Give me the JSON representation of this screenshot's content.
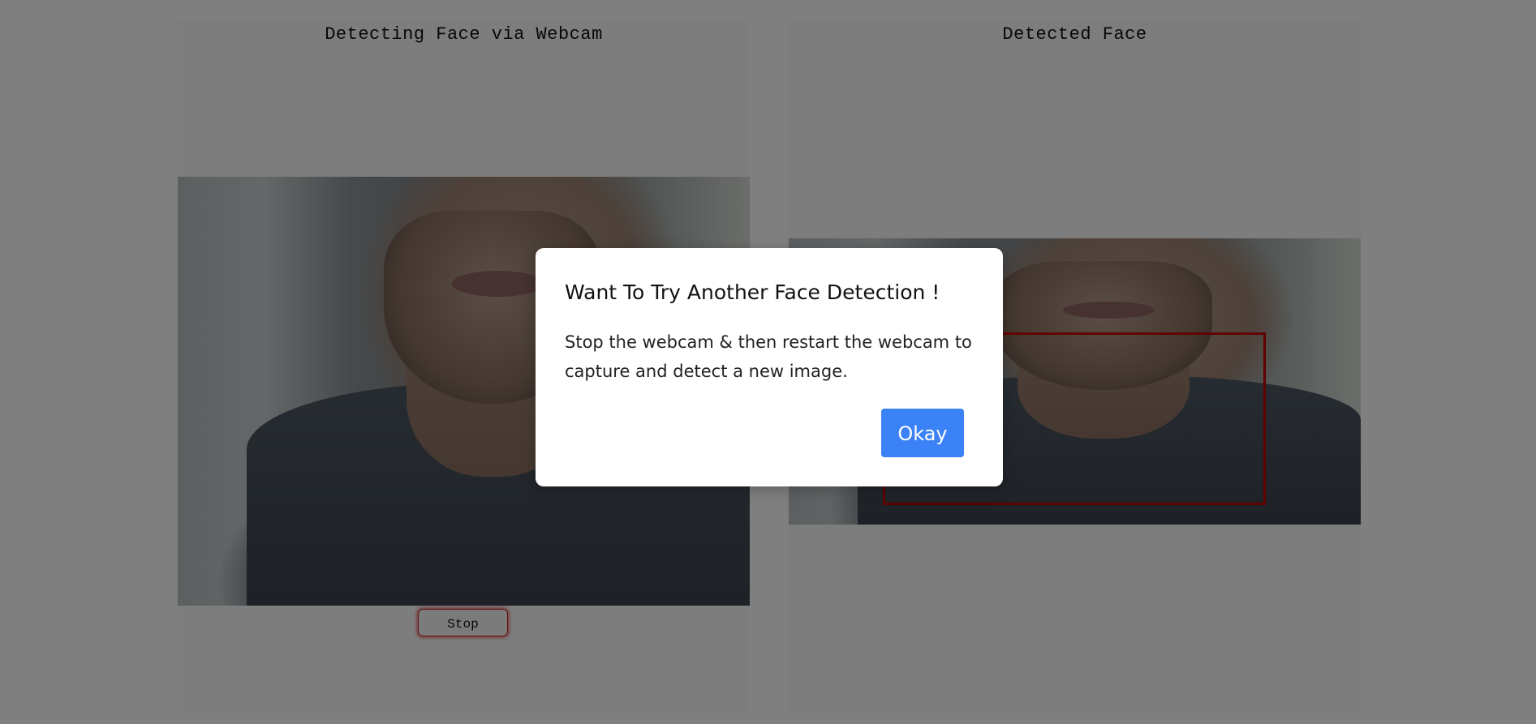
{
  "webcam_panel": {
    "title": "Detecting Face via Webcam",
    "stop_label": "Stop"
  },
  "result_panel": {
    "title": "Detected Face"
  },
  "colors": {
    "detection_box": "#c00000",
    "primary_button": "#3b82f6",
    "overlay": "rgba(0,0,0,0.5)"
  },
  "dialog": {
    "title": "Want To Try Another Face Detection !",
    "message": "Stop the webcam & then restart the webcam to capture and detect a new image.",
    "confirm_label": "Okay"
  }
}
